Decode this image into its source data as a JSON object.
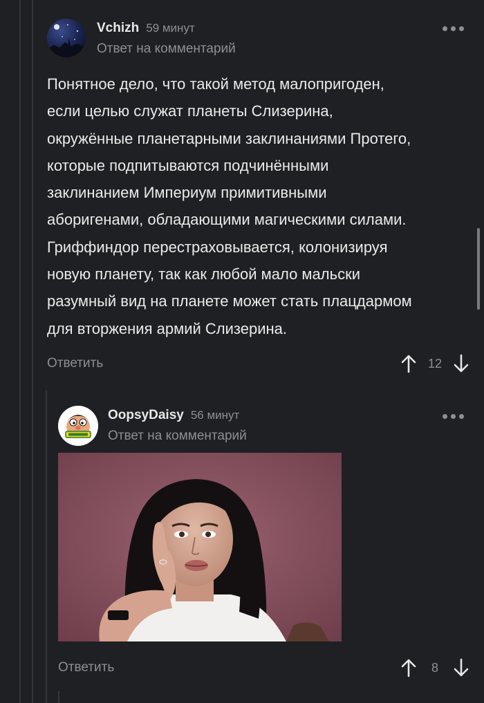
{
  "comments": [
    {
      "author": "Vchizh",
      "time": "59 минут",
      "reply_to": "Ответ на комментарий",
      "lines": [
        "Понятное дело, что такой метод малопригоден,",
        "если целью служат планеты Слизерина,",
        "окружённые планетарными заклинаниями Протего,",
        "которые подпитываются подчинёнными",
        "заклинанием Империум примитивными",
        "аборигенами, обладающими магическими силами.",
        "Гриффиндор перестраховывается, колонизируя",
        "новую планету, так как любой мало мальски",
        "разумный вид на планете может стать плацдармом",
        "для вторжения армий Слизерина."
      ],
      "reply_label": "Ответить",
      "rating": "12",
      "avatar_icon": "night-sky-avatar-icon"
    },
    {
      "author": "OopsyDaisy",
      "time": "56 минут",
      "reply_to": "Ответ на комментарий",
      "reply_label": "Ответить",
      "rating": "8",
      "avatar_icon": "cartoon-character-avatar-icon",
      "image_description_icon": "woman-photo-image"
    }
  ],
  "colors": {
    "background": "#1f2023",
    "text": "#ebebeb",
    "muted": "#8d8f93",
    "thread_line": "#34363a"
  },
  "icons": {
    "more": "more-dots-icon",
    "upvote": "arrow-up-icon",
    "downvote": "arrow-down-icon"
  }
}
